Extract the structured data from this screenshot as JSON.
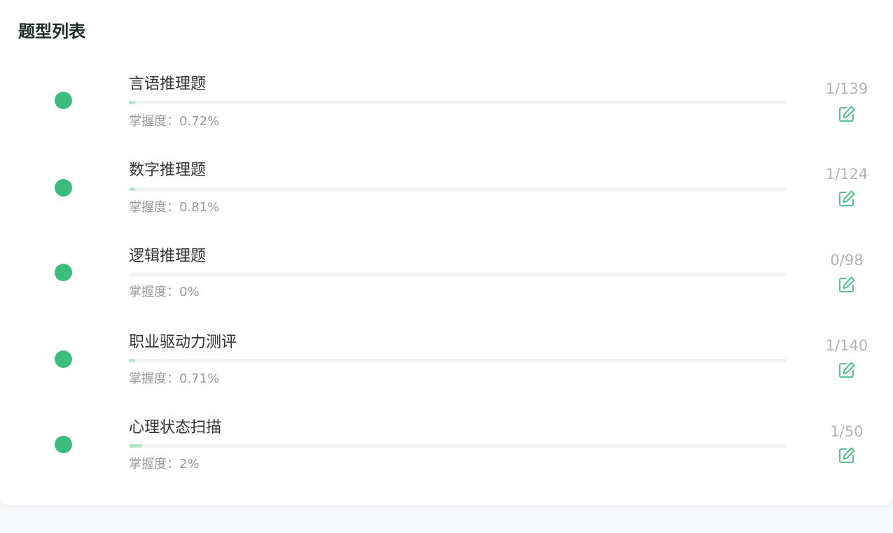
{
  "header": {
    "title": "题型列表"
  },
  "accent_color": "#3dbd7d",
  "progress_fill_color": "#b3e6c8",
  "items": [
    {
      "name": "言语推理题",
      "mastery": "掌握度：0.72%",
      "mastery_fraction": 0.0072,
      "count": "1/139",
      "icon": "edit-icon"
    },
    {
      "name": "数字推理题",
      "mastery": "掌握度：0.81%",
      "mastery_fraction": 0.0081,
      "count": "1/124",
      "icon": "edit-icon"
    },
    {
      "name": "逻辑推理题",
      "mastery": "掌握度：0%",
      "mastery_fraction": 0,
      "count": "0/98",
      "icon": "edit-icon"
    },
    {
      "name": "职业驱动力测评",
      "mastery": "掌握度：0.71%",
      "mastery_fraction": 0.0071,
      "count": "1/140",
      "icon": "edit-icon"
    },
    {
      "name": "心理状态扫描",
      "mastery": "掌握度：2%",
      "mastery_fraction": 0.02,
      "count": "1/50",
      "icon": "edit-icon"
    }
  ]
}
